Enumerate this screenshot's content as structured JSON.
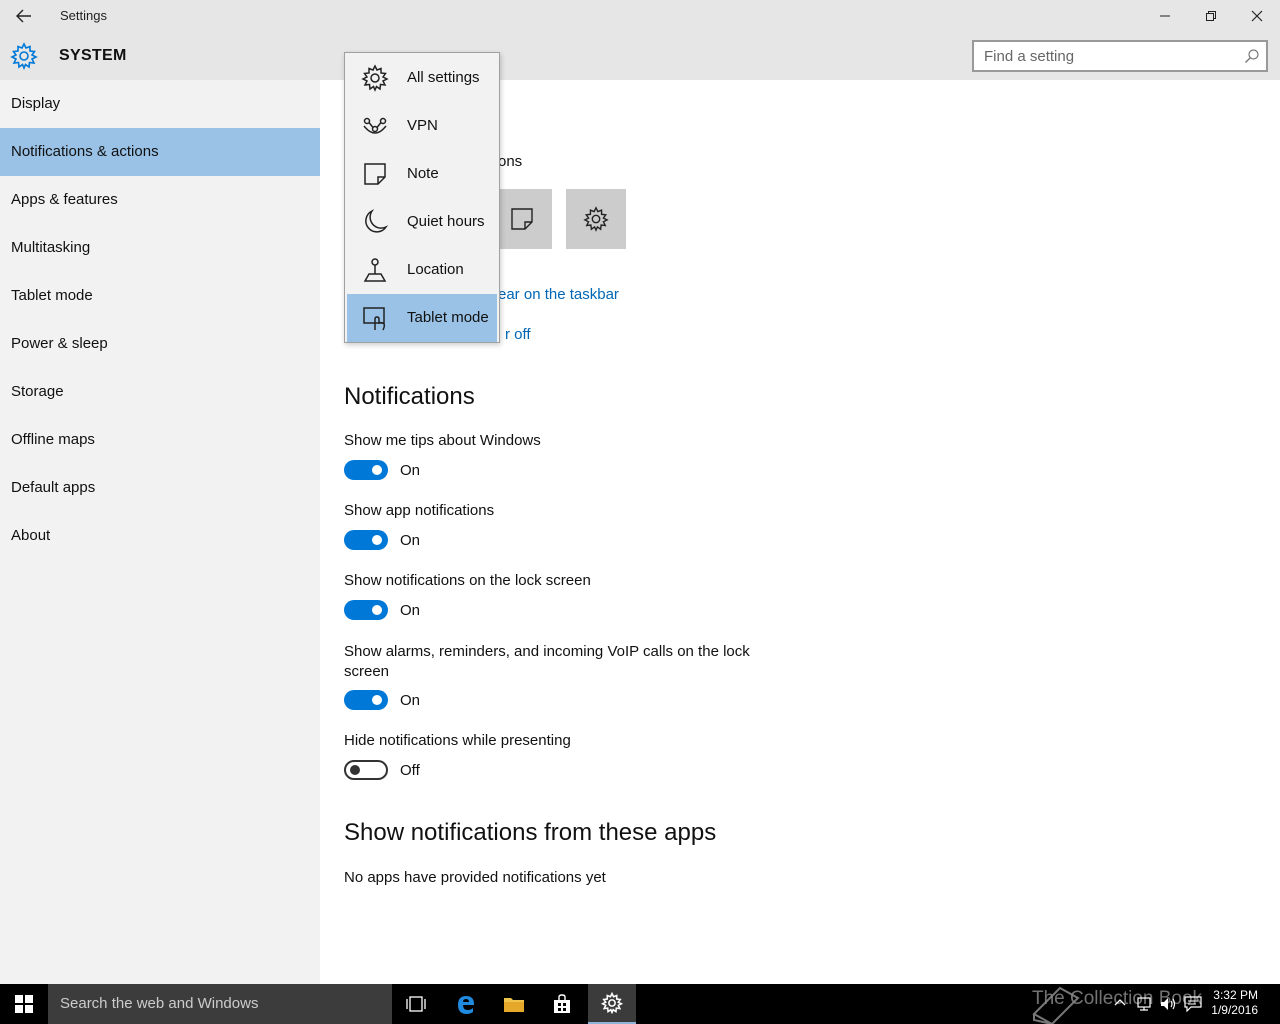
{
  "window": {
    "title": "Settings"
  },
  "header": {
    "section": "SYSTEM",
    "search_placeholder": "Find a setting"
  },
  "sidebar": {
    "items": [
      {
        "label": "Display"
      },
      {
        "label": "Notifications & actions"
      },
      {
        "label": "Apps & features"
      },
      {
        "label": "Multitasking"
      },
      {
        "label": "Tablet mode"
      },
      {
        "label": "Power & sleep"
      },
      {
        "label": "Storage"
      },
      {
        "label": "Offline maps"
      },
      {
        "label": "Default apps"
      },
      {
        "label": "About"
      }
    ]
  },
  "quick_actions": {
    "heading_fragment": "ons",
    "link_taskbar_fragment": "ear on the taskbar",
    "link_onoff_fragment": "r off"
  },
  "dropdown": {
    "items": [
      {
        "label": "All settings",
        "icon": "gear-icon"
      },
      {
        "label": "VPN",
        "icon": "vpn-icon"
      },
      {
        "label": "Note",
        "icon": "note-icon"
      },
      {
        "label": "Quiet hours",
        "icon": "moon-icon"
      },
      {
        "label": "Location",
        "icon": "location-icon"
      },
      {
        "label": "Tablet mode",
        "icon": "tablet-mode-icon"
      }
    ],
    "selected": "Tablet mode"
  },
  "notifications": {
    "heading": "Notifications",
    "settings": [
      {
        "label": "Show me tips about Windows",
        "state": "On"
      },
      {
        "label": "Show app notifications",
        "state": "On"
      },
      {
        "label": "Show notifications on the lock screen",
        "state": "On"
      },
      {
        "label": "Show alarms, reminders, and incoming VoIP calls on the lock screen",
        "state": "On"
      },
      {
        "label": "Hide notifications while presenting",
        "state": "Off"
      }
    ]
  },
  "apps_section": {
    "heading": "Show notifications from these apps",
    "empty_text": "No apps have provided notifications yet"
  },
  "taskbar": {
    "search_placeholder": "Search the web and Windows",
    "time": "3:32 PM",
    "date": "1/9/2016",
    "watermark": "The Collection Book"
  },
  "colors": {
    "accent": "#0078d7",
    "selection": "#99c2e6",
    "link": "#0066b4"
  }
}
